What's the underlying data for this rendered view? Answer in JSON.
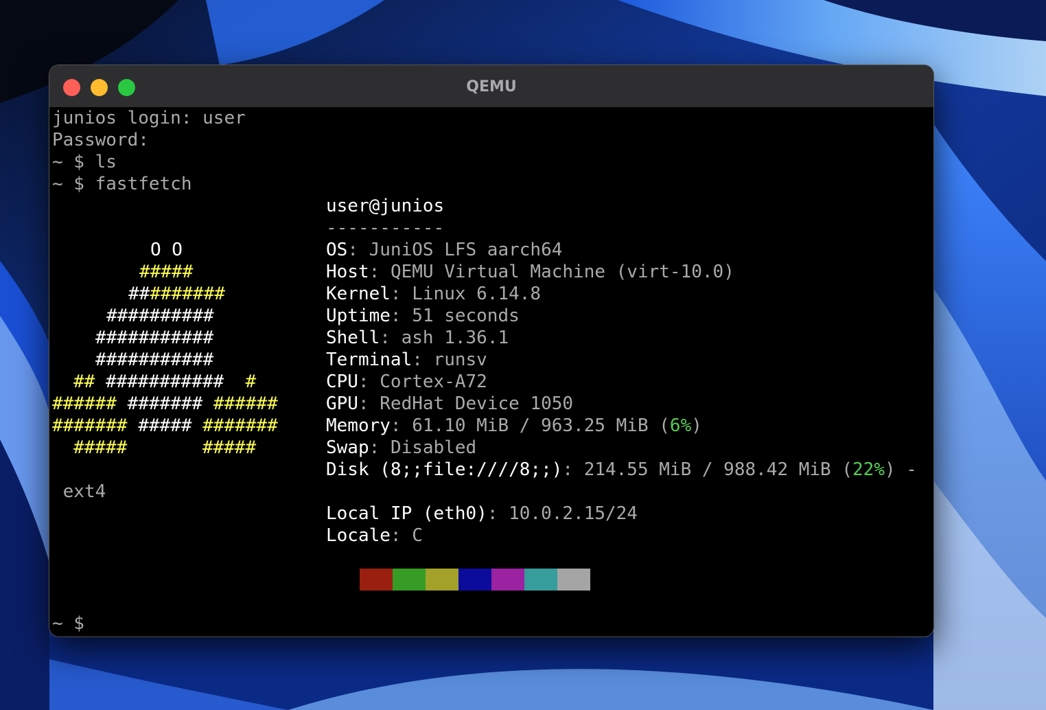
{
  "window": {
    "title": "QEMU"
  },
  "terminal": {
    "login_line": "junios login: user",
    "password_line": "Password:",
    "cmd_ls": "~ $ ls",
    "cmd_fastfetch": "~ $ fastfetch",
    "prompt_final": "~ $",
    "ext4_wrap": " ext4",
    "header": "user@junios",
    "separator": "-----------",
    "logo": {
      "line1": "O O",
      "line2": "#####",
      "line3": "#######",
      "line4": "##########",
      "line5": "###########",
      "line6": "###########",
      "line7": "## ###########  #",
      "line8": "###### ####### ######",
      "line9": "####### ##### #######",
      "line10": "#####       #####"
    },
    "info": {
      "os": {
        "key": "OS",
        "sep": ": ",
        "value": "JuniOS LFS aarch64"
      },
      "host": {
        "key": "Host",
        "sep": ": ",
        "value": "QEMU Virtual Machine (virt-10.0)"
      },
      "kernel": {
        "key": "Kernel",
        "sep": ": ",
        "value": "Linux 6.14.8"
      },
      "uptime": {
        "key": "Uptime",
        "sep": ": ",
        "value": "51 seconds"
      },
      "shell": {
        "key": "Shell",
        "sep": ": ",
        "value": "ash 1.36.1"
      },
      "terminal": {
        "key": "Terminal",
        "sep": ": ",
        "value": "runsv"
      },
      "cpu": {
        "key": "CPU",
        "sep": ": ",
        "value": "Cortex-A72"
      },
      "gpu": {
        "key": "GPU",
        "sep": ": ",
        "value": "RedHat Device 1050"
      },
      "memory": {
        "key": "Memory",
        "sep": ": ",
        "value": "61.10 MiB / 963.25 MiB (",
        "pct": "6%",
        "close": ")"
      },
      "swap": {
        "key": "Swap",
        "sep": ": ",
        "value": "Disabled"
      },
      "disk": {
        "key": "Disk (8;;file:////8;;)",
        "sep": ": ",
        "value": "214.55 MiB / 988.42 MiB (",
        "pct": "22%",
        "close": ") -"
      },
      "local_ip": {
        "key": "Local IP (eth0)",
        "sep": ": ",
        "value": "10.0.2.15/24"
      },
      "locale": {
        "key": "Locale",
        "sep": ": ",
        "value": "C"
      }
    },
    "palette": [
      "#9a1f0f",
      "#369c26",
      "#a3a12a",
      "#0c0c9c",
      "#9b22a1",
      "#369c9c",
      "#a5a5a5"
    ]
  }
}
